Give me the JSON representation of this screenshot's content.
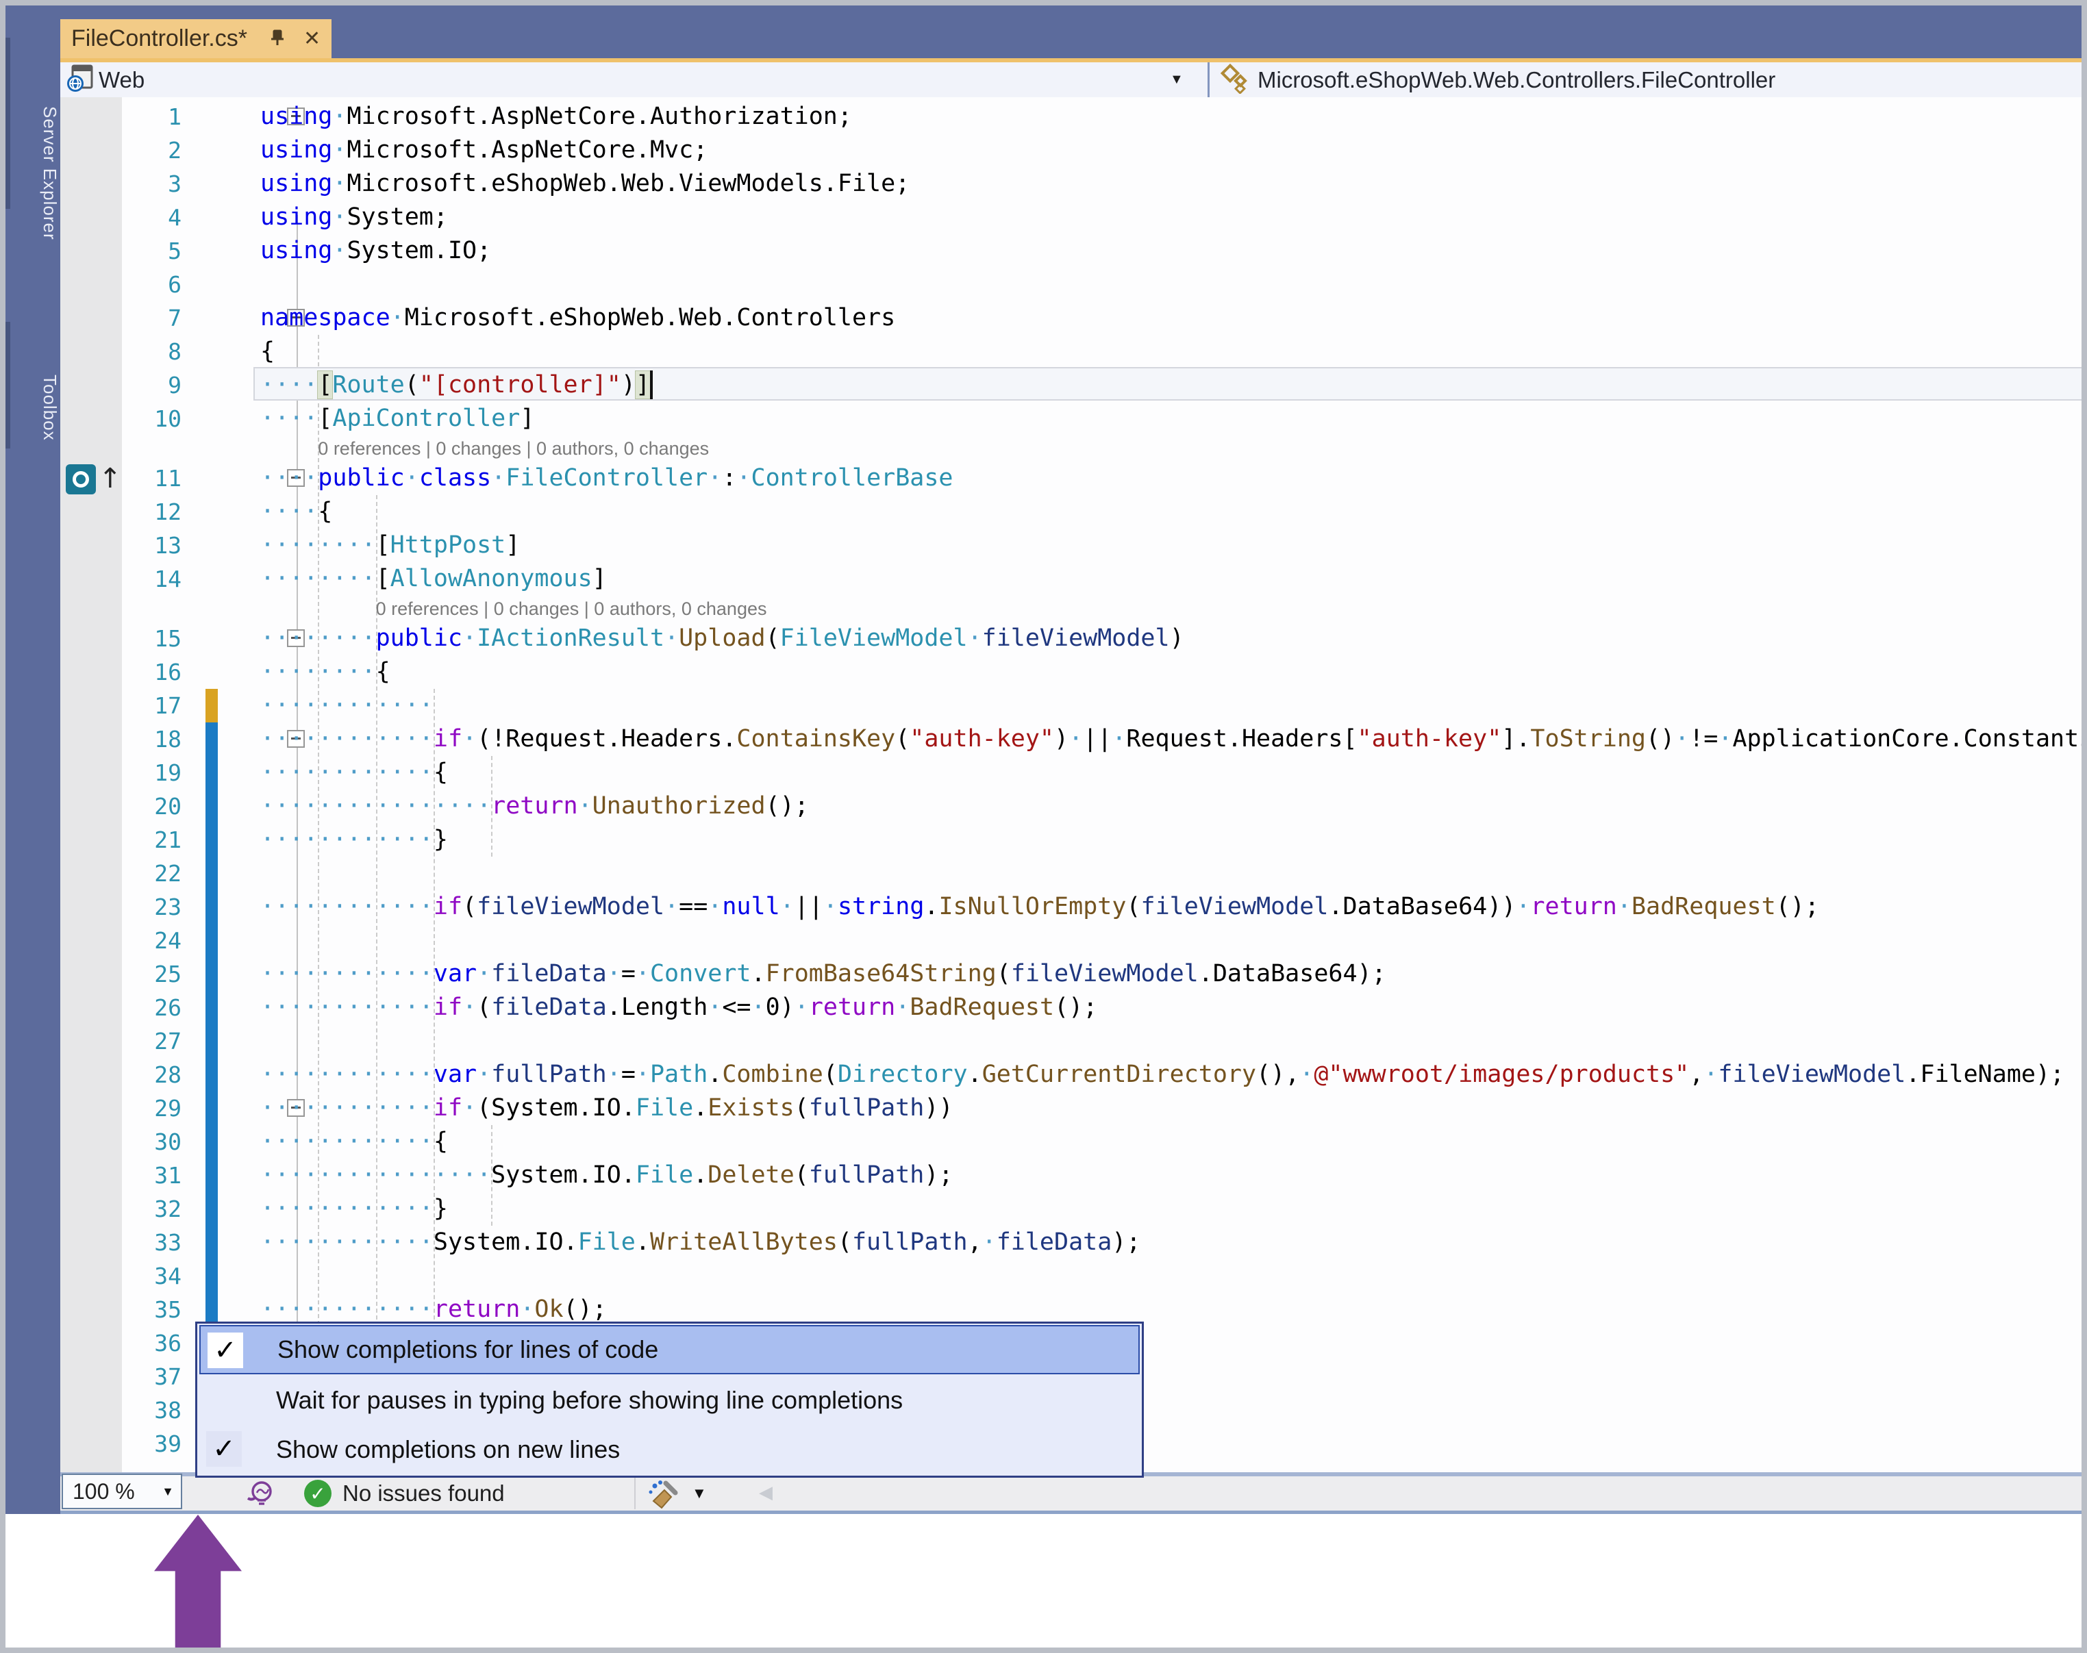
{
  "tab": {
    "title": "FileController.cs*",
    "pin_icon": "pin-icon",
    "close_icon": "close-icon"
  },
  "sidebar": {
    "items": [
      {
        "label": "Server Explorer"
      },
      {
        "label": "Toolbox"
      }
    ]
  },
  "nav": {
    "project_label": "Web",
    "member_label": "Microsoft.eShopWeb.Web.Controllers.FileController",
    "dropdown_icon": "chevron-down-icon"
  },
  "editor": {
    "codelens_label": "0 references | 0 changes | 0 authors, 0 changes",
    "caret": {
      "line": 9,
      "col": 27
    },
    "change_bars": {
      "unsaved_color": "#d9a322",
      "saved_color": "#1b7bc4",
      "unsaved_lines": "17",
      "saved_lines": "18-35"
    },
    "lines": [
      {
        "n": 1,
        "fold": true,
        "segs": [
          [
            "kw",
            "using"
          ],
          [
            "ws",
            "·"
          ],
          [
            "pl",
            "Microsoft.AspNetCore.Authorization;"
          ]
        ]
      },
      {
        "n": 2,
        "segs": [
          [
            "kw",
            "using"
          ],
          [
            "ws",
            "·"
          ],
          [
            "pl",
            "Microsoft.AspNetCore.Mvc;"
          ]
        ]
      },
      {
        "n": 3,
        "segs": [
          [
            "kw",
            "using"
          ],
          [
            "ws",
            "·"
          ],
          [
            "pl",
            "Microsoft.eShopWeb.Web.ViewModels.File;"
          ]
        ]
      },
      {
        "n": 4,
        "segs": [
          [
            "kw",
            "using"
          ],
          [
            "ws",
            "·"
          ],
          [
            "pl",
            "System;"
          ]
        ]
      },
      {
        "n": 5,
        "segs": [
          [
            "kw",
            "using"
          ],
          [
            "ws",
            "·"
          ],
          [
            "pl",
            "System.IO;"
          ]
        ]
      },
      {
        "n": 6,
        "segs": []
      },
      {
        "n": 7,
        "fold": true,
        "segs": [
          [
            "kw",
            "namespace"
          ],
          [
            "ws",
            "·"
          ],
          [
            "pl",
            "Microsoft.eShopWeb.Web.Controllers"
          ]
        ]
      },
      {
        "n": 8,
        "segs": [
          [
            "pl",
            "{"
          ]
        ]
      },
      {
        "n": 9,
        "current": true,
        "segs": [
          [
            "ws",
            "····"
          ],
          [
            "hlb",
            "["
          ],
          [
            "typ",
            "Route"
          ],
          [
            "pl",
            "("
          ],
          [
            "str",
            "\"[controller]\""
          ],
          [
            "pl",
            ")"
          ],
          [
            "hlb",
            "]"
          ]
        ]
      },
      {
        "n": 10,
        "segs": [
          [
            "ws",
            "····"
          ],
          [
            "pl",
            "["
          ],
          [
            "typ",
            "ApiController"
          ],
          [
            "pl",
            "]"
          ]
        ]
      },
      {
        "codelens": true,
        "col": 4
      },
      {
        "n": 11,
        "fold": true,
        "reficon": true,
        "segs": [
          [
            "ws",
            "····"
          ],
          [
            "kw",
            "public"
          ],
          [
            "ws",
            "·"
          ],
          [
            "kw",
            "class"
          ],
          [
            "ws",
            "·"
          ],
          [
            "typ",
            "FileController"
          ],
          [
            "ws",
            "·"
          ],
          [
            "pl",
            ":"
          ],
          [
            "ws",
            "·"
          ],
          [
            "typ",
            "ControllerBase"
          ]
        ]
      },
      {
        "n": 12,
        "segs": [
          [
            "ws",
            "····"
          ],
          [
            "pl",
            "{"
          ]
        ]
      },
      {
        "n": 13,
        "segs": [
          [
            "ws",
            "········"
          ],
          [
            "pl",
            "["
          ],
          [
            "typ",
            "HttpPost"
          ],
          [
            "pl",
            "]"
          ]
        ]
      },
      {
        "n": 14,
        "segs": [
          [
            "ws",
            "········"
          ],
          [
            "pl",
            "["
          ],
          [
            "typ",
            "AllowAnonymous"
          ],
          [
            "pl",
            "]"
          ]
        ]
      },
      {
        "codelens": true,
        "col": 8
      },
      {
        "n": 15,
        "fold": true,
        "segs": [
          [
            "ws",
            "········"
          ],
          [
            "kw",
            "public"
          ],
          [
            "ws",
            "·"
          ],
          [
            "typ",
            "IActionResult"
          ],
          [
            "ws",
            "·"
          ],
          [
            "met",
            "Upload"
          ],
          [
            "pl",
            "("
          ],
          [
            "typ",
            "FileViewModel"
          ],
          [
            "ws",
            "·"
          ],
          [
            "loc",
            "fileViewModel"
          ],
          [
            "pl",
            ")"
          ]
        ]
      },
      {
        "n": 16,
        "segs": [
          [
            "ws",
            "········"
          ],
          [
            "pl",
            "{"
          ]
        ]
      },
      {
        "n": 17,
        "segs": [
          [
            "ws",
            "············"
          ]
        ]
      },
      {
        "n": 18,
        "fold": true,
        "segs": [
          [
            "ws",
            "············"
          ],
          [
            "ctrl",
            "if"
          ],
          [
            "ws",
            "·"
          ],
          [
            "pl",
            "(!Request.Headers."
          ],
          [
            "met",
            "ContainsKey"
          ],
          [
            "pl",
            "("
          ],
          [
            "str",
            "\"auth-key\""
          ],
          [
            "pl",
            ")"
          ],
          [
            "ws",
            "·"
          ],
          [
            "pl",
            "||"
          ],
          [
            "ws",
            "·"
          ],
          [
            "pl",
            "Request.Headers["
          ],
          [
            "str",
            "\"auth-key\""
          ],
          [
            "pl",
            "]."
          ],
          [
            "met",
            "ToString"
          ],
          [
            "pl",
            "()"
          ],
          [
            "ws",
            "·"
          ],
          [
            "pl",
            "!="
          ],
          [
            "ws",
            "·"
          ],
          [
            "pl",
            "ApplicationCore.Constants"
          ]
        ]
      },
      {
        "n": 19,
        "segs": [
          [
            "ws",
            "············"
          ],
          [
            "pl",
            "{"
          ]
        ]
      },
      {
        "n": 20,
        "segs": [
          [
            "ws",
            "················"
          ],
          [
            "ctrl",
            "return"
          ],
          [
            "ws",
            "·"
          ],
          [
            "met",
            "Unauthorized"
          ],
          [
            "pl",
            "();"
          ]
        ]
      },
      {
        "n": 21,
        "segs": [
          [
            "ws",
            "············"
          ],
          [
            "pl",
            "}"
          ]
        ]
      },
      {
        "n": 22,
        "segs": []
      },
      {
        "n": 23,
        "segs": [
          [
            "ws",
            "············"
          ],
          [
            "ctrl",
            "if"
          ],
          [
            "pl",
            "("
          ],
          [
            "loc",
            "fileViewModel"
          ],
          [
            "ws",
            "·"
          ],
          [
            "pl",
            "=="
          ],
          [
            "ws",
            "·"
          ],
          [
            "kw",
            "null"
          ],
          [
            "ws",
            "·"
          ],
          [
            "pl",
            "||"
          ],
          [
            "ws",
            "·"
          ],
          [
            "kw",
            "string"
          ],
          [
            "pl",
            "."
          ],
          [
            "met",
            "IsNullOrEmpty"
          ],
          [
            "pl",
            "("
          ],
          [
            "loc",
            "fileViewModel"
          ],
          [
            "pl",
            ".DataBase64))"
          ],
          [
            "ws",
            "·"
          ],
          [
            "ctrl",
            "return"
          ],
          [
            "ws",
            "·"
          ],
          [
            "met",
            "BadRequest"
          ],
          [
            "pl",
            "();"
          ]
        ]
      },
      {
        "n": 24,
        "segs": []
      },
      {
        "n": 25,
        "segs": [
          [
            "ws",
            "············"
          ],
          [
            "kw",
            "var"
          ],
          [
            "ws",
            "·"
          ],
          [
            "loc",
            "fileData"
          ],
          [
            "ws",
            "·"
          ],
          [
            "pl",
            "="
          ],
          [
            "ws",
            "·"
          ],
          [
            "typ",
            "Convert"
          ],
          [
            "pl",
            "."
          ],
          [
            "met",
            "FromBase64String"
          ],
          [
            "pl",
            "("
          ],
          [
            "loc",
            "fileViewModel"
          ],
          [
            "pl",
            ".DataBase64);"
          ]
        ]
      },
      {
        "n": 26,
        "segs": [
          [
            "ws",
            "············"
          ],
          [
            "ctrl",
            "if"
          ],
          [
            "ws",
            "·"
          ],
          [
            "pl",
            "("
          ],
          [
            "loc",
            "fileData"
          ],
          [
            "pl",
            ".Length"
          ],
          [
            "ws",
            "·"
          ],
          [
            "pl",
            "<="
          ],
          [
            "ws",
            "·"
          ],
          [
            "pl",
            "0)"
          ],
          [
            "ws",
            "·"
          ],
          [
            "ctrl",
            "return"
          ],
          [
            "ws",
            "·"
          ],
          [
            "met",
            "BadRequest"
          ],
          [
            "pl",
            "();"
          ]
        ]
      },
      {
        "n": 27,
        "segs": []
      },
      {
        "n": 28,
        "segs": [
          [
            "ws",
            "············"
          ],
          [
            "kw",
            "var"
          ],
          [
            "ws",
            "·"
          ],
          [
            "loc",
            "fullPath"
          ],
          [
            "ws",
            "·"
          ],
          [
            "pl",
            "="
          ],
          [
            "ws",
            "·"
          ],
          [
            "typ",
            "Path"
          ],
          [
            "pl",
            "."
          ],
          [
            "met",
            "Combine"
          ],
          [
            "pl",
            "("
          ],
          [
            "typ",
            "Directory"
          ],
          [
            "pl",
            "."
          ],
          [
            "met",
            "GetCurrentDirectory"
          ],
          [
            "pl",
            "(),"
          ],
          [
            "ws",
            "·"
          ],
          [
            "str",
            "@\"wwwroot/images/products\""
          ],
          [
            "pl",
            ","
          ],
          [
            "ws",
            "·"
          ],
          [
            "loc",
            "fileViewModel"
          ],
          [
            "pl",
            ".FileName);"
          ]
        ]
      },
      {
        "n": 29,
        "fold": true,
        "segs": [
          [
            "ws",
            "············"
          ],
          [
            "ctrl",
            "if"
          ],
          [
            "ws",
            "·"
          ],
          [
            "pl",
            "(System.IO."
          ],
          [
            "typ",
            "File"
          ],
          [
            "pl",
            "."
          ],
          [
            "met",
            "Exists"
          ],
          [
            "pl",
            "("
          ],
          [
            "loc",
            "fullPath"
          ],
          [
            "pl",
            "))"
          ]
        ]
      },
      {
        "n": 30,
        "segs": [
          [
            "ws",
            "············"
          ],
          [
            "pl",
            "{"
          ]
        ]
      },
      {
        "n": 31,
        "segs": [
          [
            "ws",
            "················"
          ],
          [
            "pl",
            "System.IO."
          ],
          [
            "typ",
            "File"
          ],
          [
            "pl",
            "."
          ],
          [
            "met",
            "Delete"
          ],
          [
            "pl",
            "("
          ],
          [
            "loc",
            "fullPath"
          ],
          [
            "pl",
            ");"
          ]
        ]
      },
      {
        "n": 32,
        "segs": [
          [
            "ws",
            "············"
          ],
          [
            "pl",
            "}"
          ]
        ]
      },
      {
        "n": 33,
        "segs": [
          [
            "ws",
            "············"
          ],
          [
            "pl",
            "System.IO."
          ],
          [
            "typ",
            "File"
          ],
          [
            "pl",
            "."
          ],
          [
            "met",
            "WriteAllBytes"
          ],
          [
            "pl",
            "("
          ],
          [
            "loc",
            "fullPath"
          ],
          [
            "pl",
            ","
          ],
          [
            "ws",
            "·"
          ],
          [
            "loc",
            "fileData"
          ],
          [
            "pl",
            ");"
          ]
        ]
      },
      {
        "n": 34,
        "segs": []
      },
      {
        "n": 35,
        "segs": [
          [
            "ws",
            "············"
          ],
          [
            "ctrl",
            "return"
          ],
          [
            "ws",
            "·"
          ],
          [
            "met",
            "Ok"
          ],
          [
            "pl",
            "();"
          ]
        ]
      },
      {
        "n": 36,
        "segs": []
      },
      {
        "n": 37,
        "segs": []
      },
      {
        "n": 38,
        "segs": []
      },
      {
        "n": 39,
        "segs": []
      }
    ]
  },
  "popup": {
    "items": [
      {
        "label": "Show completions for lines of code",
        "checked": true,
        "highlighted": true
      },
      {
        "label": "Wait for pauses in typing before showing line completions",
        "checked": false,
        "highlighted": false
      },
      {
        "label": "Show completions on new lines",
        "checked": true,
        "highlighted": false
      }
    ],
    "check_glyph": "✓"
  },
  "statusbar": {
    "zoom_level": "100 %",
    "status_message": "No issues found",
    "icons": [
      "intellicode-icon",
      "issues-ok-icon",
      "code-cleanup-broom-icon",
      "chevron-down-icon",
      "scroll-left-icon"
    ]
  },
  "annotation": {
    "arrow_color": "#7d3e98",
    "arrow_points_at": "intellicode-icon"
  },
  "colors": {
    "titlebar_blue": "#5c6b9c",
    "active_tab_gold": "#f2cb87",
    "accent_strip": "#efc16b",
    "keyword": "#0000e8",
    "control_keyword": "#8f08c4",
    "type": "#2b91af",
    "method": "#74531f",
    "string": "#a31515",
    "local": "#1f377f",
    "line_number": "#2b91af",
    "popup_bg": "#e7ebfa",
    "popup_highlight": "#a9bef0",
    "change_unsaved": "#d9a322",
    "change_saved": "#1b7bc4"
  }
}
